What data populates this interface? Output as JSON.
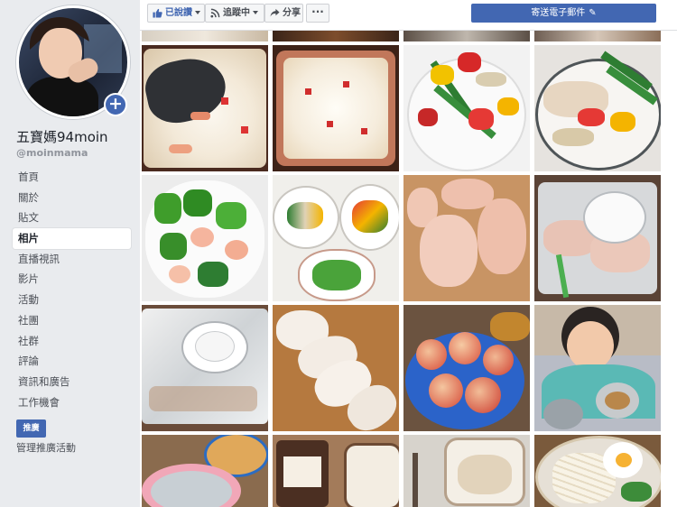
{
  "profile": {
    "name": "五寶媽94moin",
    "handle": "@moinmama",
    "add_photo_icon": "plus-icon"
  },
  "nav": {
    "items": [
      {
        "label": "首頁",
        "active": false
      },
      {
        "label": "關於",
        "active": false
      },
      {
        "label": "貼文",
        "active": false
      },
      {
        "label": "相片",
        "active": true
      },
      {
        "label": "直播視訊",
        "active": false
      },
      {
        "label": "影片",
        "active": false
      },
      {
        "label": "活動",
        "active": false
      },
      {
        "label": "社團",
        "active": false
      },
      {
        "label": "社群",
        "active": false
      },
      {
        "label": "評論",
        "active": false
      },
      {
        "label": "資訊和廣告",
        "active": false
      },
      {
        "label": "工作機會",
        "active": false
      }
    ],
    "promote_label": "推廣",
    "manage_promotions_label": "管理推廣活動"
  },
  "toolbar": {
    "liked_label": "已說讚",
    "following_label": "追蹤中",
    "share_label": "分享",
    "more_label": "···",
    "email_label": "寄送電子郵件",
    "accent_color": "#4267b2"
  },
  "photos": [
    {
      "name": "photo-partial-top-1",
      "icon": "food-photo"
    },
    {
      "name": "photo-partial-top-2",
      "icon": "food-photo"
    },
    {
      "name": "photo-partial-top-3",
      "icon": "food-photo"
    },
    {
      "name": "photo-partial-top-4",
      "icon": "food-photo"
    },
    {
      "name": "photo-shrimp-cream-gratin-spoon",
      "icon": "food-photo"
    },
    {
      "name": "photo-shrimp-cream-gratin-dish",
      "icon": "food-photo"
    },
    {
      "name": "photo-stirfry-peppers-asparagus",
      "icon": "food-photo"
    },
    {
      "name": "photo-chicken-asparagus-plate",
      "icon": "food-photo"
    },
    {
      "name": "photo-green-pepper-shrimp",
      "icon": "food-photo"
    },
    {
      "name": "photo-three-plates",
      "icon": "food-photo"
    },
    {
      "name": "photo-raw-chicken-board",
      "icon": "food-photo"
    },
    {
      "name": "photo-chicken-in-tray-with-plate",
      "icon": "food-photo"
    },
    {
      "name": "photo-tray-plate-foil",
      "icon": "food-photo"
    },
    {
      "name": "photo-sliced-chicken-breast",
      "icon": "food-photo"
    },
    {
      "name": "photo-apples-bowl",
      "icon": "food-photo"
    },
    {
      "name": "photo-child-eating",
      "icon": "food-photo"
    },
    {
      "name": "photo-bottom-bowl",
      "icon": "food-photo"
    },
    {
      "name": "photo-bottom-milk-jar",
      "icon": "food-photo"
    },
    {
      "name": "photo-bottom-soy-milk",
      "icon": "food-photo"
    },
    {
      "name": "photo-bottom-udon-egg",
      "icon": "food-photo"
    }
  ]
}
